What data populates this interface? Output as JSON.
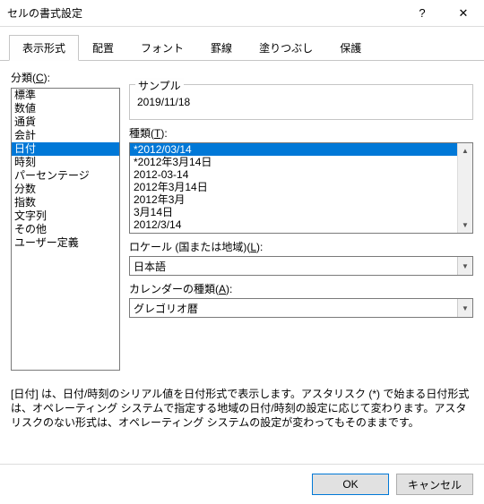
{
  "title": "セルの書式設定",
  "tabs": [
    "表示形式",
    "配置",
    "フォント",
    "罫線",
    "塗りつぶし",
    "保護"
  ],
  "active_tab": 0,
  "labels": {
    "category": "分類(",
    "category_key": "C",
    "category_suffix": "):",
    "sample": "サンプル",
    "type": "種類(",
    "type_key": "T",
    "type_suffix": "):",
    "locale": "ロケール (国または地域)(",
    "locale_key": "L",
    "locale_suffix": "):",
    "calendar": "カレンダーの種類(",
    "calendar_key": "A",
    "calendar_suffix": "):"
  },
  "categories": {
    "items": [
      "標準",
      "数値",
      "通貨",
      "会計",
      "日付",
      "時刻",
      "パーセンテージ",
      "分数",
      "指数",
      "文字列",
      "その他",
      "ユーザー定義"
    ],
    "selected_index": 4
  },
  "sample_value": "2019/11/18",
  "types": {
    "items": [
      "*2012/03/14",
      "*2012年3月14日",
      "2012-03-14",
      "2012年3月14日",
      "2012年3月",
      "3月14日",
      "2012/3/14"
    ],
    "selected_index": 0
  },
  "locale_value": "日本語",
  "calendar_value": "グレゴリオ暦",
  "description": "[日付] は、日付/時刻のシリアル値を日付形式で表示します。アスタリスク (*) で始まる日付形式は、オペレーティング システムで指定する地域の日付/時刻の設定に応じて変わります。アスタリスクのない形式は、オペレーティング システムの設定が変わってもそのままです。",
  "buttons": {
    "ok": "OK",
    "cancel": "キャンセル"
  }
}
